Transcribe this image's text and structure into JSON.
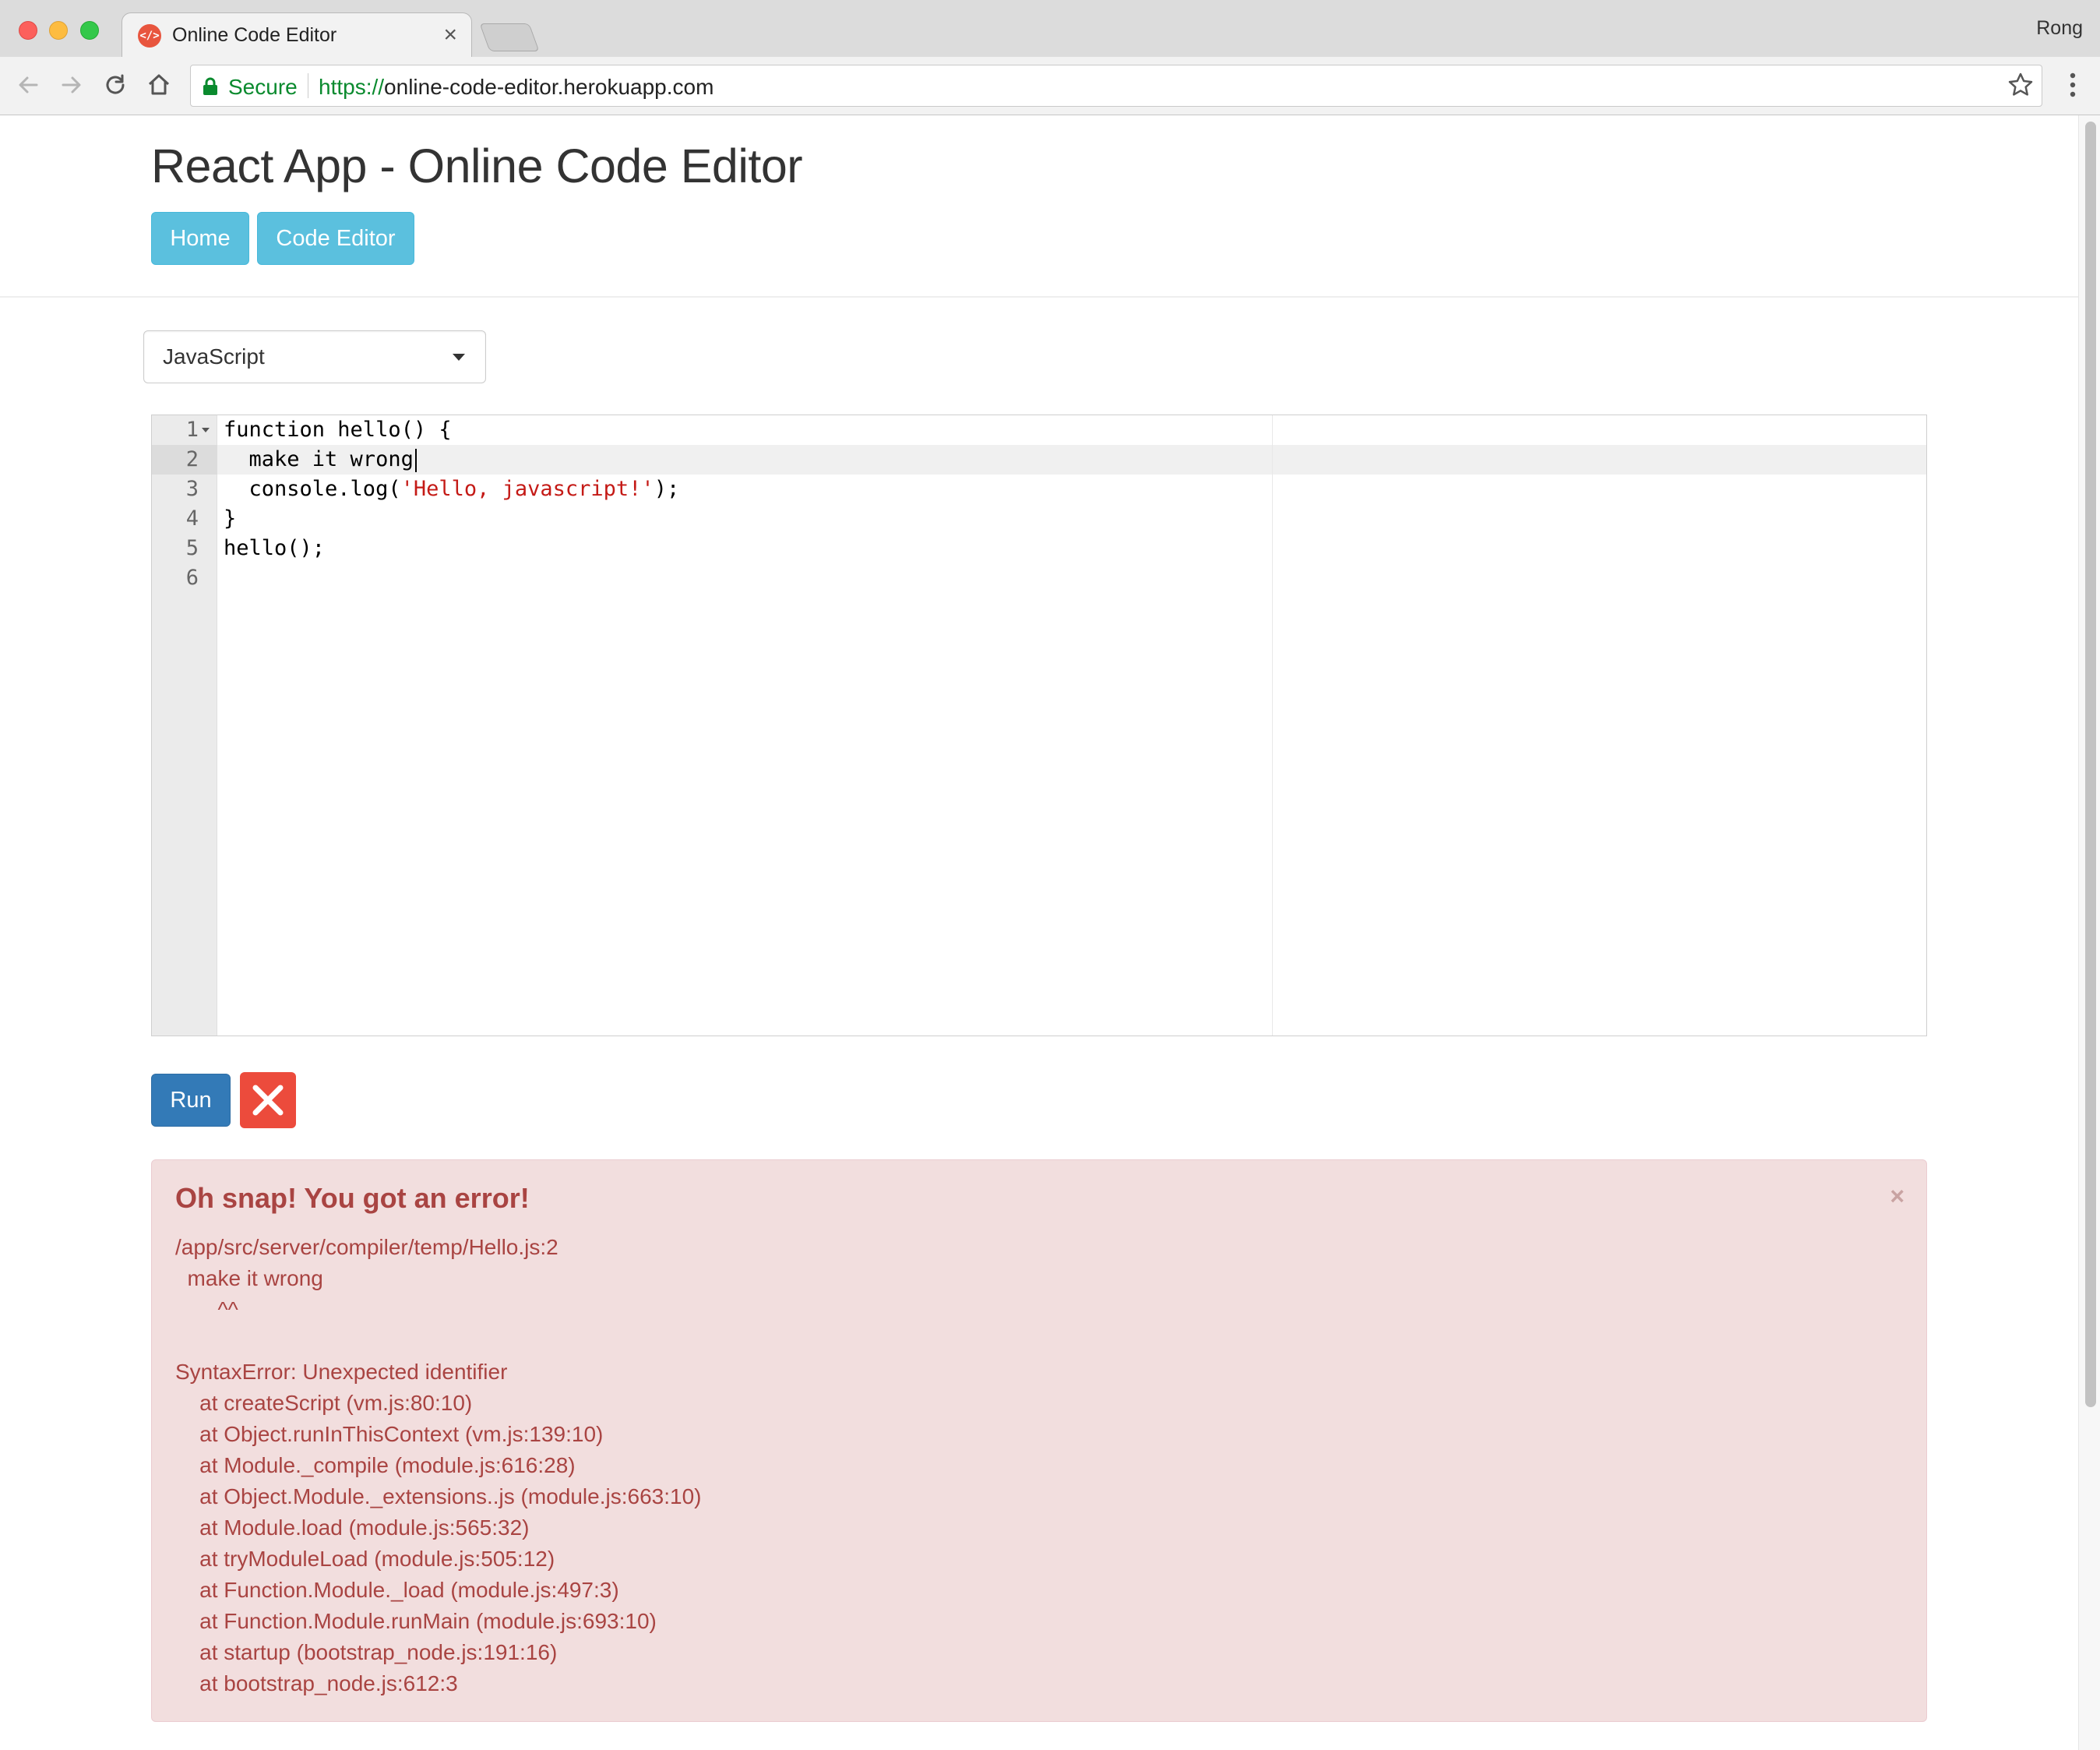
{
  "browser": {
    "tab_title": "Online Code Editor",
    "tab_close": "×",
    "profile_name": "Rong",
    "secure_label": "Secure",
    "url_scheme": "https://",
    "url_host": "online-code-editor.herokuapp.com"
  },
  "header": {
    "title": "React App - Online Code Editor",
    "nav": {
      "home_label": "Home",
      "code_editor_label": "Code Editor"
    }
  },
  "language_select": {
    "value": "JavaScript"
  },
  "editor": {
    "line_numbers": [
      "1",
      "2",
      "3",
      "4",
      "5",
      "6"
    ],
    "lines": {
      "l1": "function hello() {",
      "l2": "  make it wrong",
      "l3_prefix": "  console.log(",
      "l3_string": "'Hello, javascript!'",
      "l3_suffix": ");",
      "l4": "}",
      "l5": "hello();",
      "l6": ""
    },
    "active_line": 2
  },
  "actions": {
    "run_label": "Run"
  },
  "alert": {
    "title": "Oh snap! You got an error!",
    "close": "×",
    "body": "/app/src/server/compiler/temp/Hello.js:2\n  make it wrong\n       ^^\n\nSyntaxError: Unexpected identifier\n    at createScript (vm.js:80:10)\n    at Object.runInThisContext (vm.js:139:10)\n    at Module._compile (module.js:616:28)\n    at Object.Module._extensions..js (module.js:663:10)\n    at Module.load (module.js:565:32)\n    at tryModuleLoad (module.js:505:12)\n    at Function.Module._load (module.js:497:3)\n    at Function.Module.runMain (module.js:693:10)\n    at startup (bootstrap_node.js:191:16)\n    at bootstrap_node.js:612:3"
  },
  "colors": {
    "info_button": "#5bc0de",
    "primary_button": "#337ab7",
    "danger_button": "#ec4b3c",
    "alert_bg": "#f2dede",
    "alert_text": "#a94442",
    "code_string": "#c41a16"
  }
}
